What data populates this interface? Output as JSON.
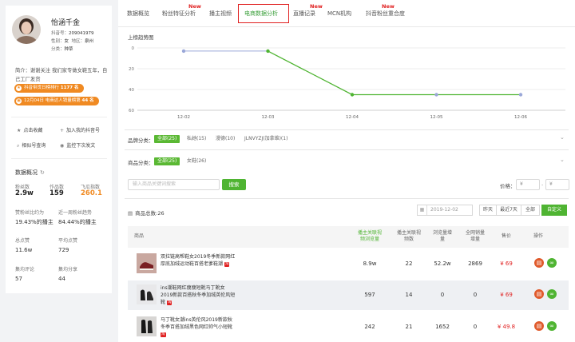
{
  "profile": {
    "name": "怡涵千金",
    "douyin_id_label": "抖音号：",
    "douyin_id": "209041979",
    "gender_label": "性别：",
    "gender": "女",
    "region_label": "地区：",
    "region": "泉州",
    "category_label": "分类：",
    "category": "种草",
    "intro": "简介：谢谢关注 我们家专做女鞋五年，自己工厂发货",
    "badge1": {
      "text": "抖音带货日榜排行",
      "num": "1177 名"
    },
    "badge2": {
      "text": "12月04日 电商达人销量榜第",
      "num": "44 名"
    }
  },
  "actions": {
    "collect": "点击收藏",
    "add_mine": "加入我的抖音号",
    "similar": "相似号查询",
    "monitor": "监控下次发文"
  },
  "overview": {
    "title": "数据概况",
    "fans_label": "粉丝数",
    "fans": "2.9w",
    "works_label": "作品数",
    "works": "159",
    "tatu_label": "飞瓜指数",
    "tatu": "260.1",
    "like_rate_label": "赞粉丝比约为",
    "like_rate": "19.43%的播主",
    "growth_label": "近一周粉丝趋势",
    "growth": "84.44%的播主",
    "total_likes_label": "总点赞",
    "total_likes": "11.6w",
    "avg_likes_label": "平均点赞",
    "avg_likes": "729",
    "avg_comments_label": "集均评论",
    "avg_comments": "57",
    "avg_shares_label": "集均分享",
    "avg_shares": "44"
  },
  "tabs": [
    {
      "label": "数据概览"
    },
    {
      "label": "粉丝特征分析"
    },
    {
      "label": "播主视频"
    },
    {
      "label": "电商数据分析"
    },
    {
      "label": "直播记录"
    },
    {
      "label": "MCN机构"
    },
    {
      "label": "抖音粉丝重合度"
    }
  ],
  "new_badge": "New",
  "chart_data": {
    "type": "line",
    "title": "上榜趋势图",
    "x": [
      "12-02",
      "12-03",
      "12-04",
      "12-05",
      "12-06"
    ],
    "y_ticks": [
      "0",
      "20",
      "40",
      "60"
    ],
    "series": [
      {
        "values": [
          3,
          3,
          45,
          45,
          45
        ]
      }
    ],
    "ylim": [
      0,
      60
    ],
    "y_inverted": true,
    "colors": {
      "line": "#4fb432",
      "point": "#9aa7d8",
      "active_point": "#4fb432"
    }
  },
  "filters": {
    "brand_label": "品牌分类：",
    "brands": [
      "全部(25)",
      "私她(15)",
      "漫德(10)",
      "JLNVYZJ(加拿维)(1)"
    ],
    "product_label": "商品分类：",
    "products": [
      "全部(25)",
      "女鞋(26)"
    ],
    "search_placeholder": "输入商品关键词搜索",
    "search_btn": "搜索",
    "price_label": "价格：",
    "price_min": "¥",
    "price_max": "¥"
  },
  "goods": {
    "total_label": "商品总数:26",
    "date": "2019-12-02",
    "ranges": [
      "昨天",
      "最近7天",
      "全部",
      "自定义"
    ]
  },
  "table": {
    "headers": {
      "product": "商品",
      "orders": "播主关联视频浏览量",
      "videos": "播主关联视频数",
      "views": "浏览量增量",
      "total": "全网销量增量",
      "price": "售价",
      "ops": "操作"
    },
    "rows": [
      {
        "title": "双拉链高帮鞋女2019冬季新款网红厚底加绒运动鞋百搭老爹鞋潮",
        "orders": "8.9w",
        "videos": "22",
        "views": "52.2w",
        "total": "2869",
        "price": "¥ 69"
      },
      {
        "title": "ins潮鞋网红瘦瘦短靴马丁靴女2019新款百搭秋冬季加绒英伦风短靴",
        "orders": "597",
        "videos": "14",
        "views": "0",
        "total": "0",
        "price": "¥ 69"
      },
      {
        "title": "马丁靴女潮ins英伦风2019新款秋冬季百搭加绒黑色网红帅气小短靴",
        "orders": "242",
        "videos": "21",
        "views": "1652",
        "total": "0",
        "price": "¥ 49.8"
      }
    ]
  }
}
